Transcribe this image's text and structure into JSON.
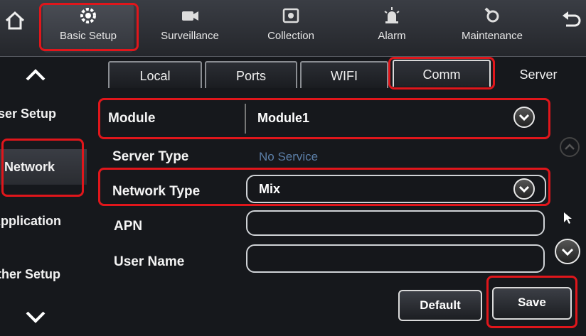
{
  "nav": {
    "items": [
      {
        "label": "Basic Setup",
        "icon": "gear-icon"
      },
      {
        "label": "Surveillance",
        "icon": "camera-icon"
      },
      {
        "label": "Collection",
        "icon": "record-icon"
      },
      {
        "label": "Alarm",
        "icon": "alarm-icon"
      },
      {
        "label": "Maintenance",
        "icon": "wrench-icon"
      }
    ]
  },
  "tabs": [
    "Local",
    "Ports",
    "WIFI",
    "Comm",
    "Server"
  ],
  "side": [
    "User Setup",
    "Network",
    "Application",
    "Other Setup"
  ],
  "form": {
    "module_label": "Module",
    "module_value": "Module1",
    "server_type_label": "Server Type",
    "server_type_value": "No Service",
    "network_type_label": "Network Type",
    "network_type_value": "Mix",
    "apn_label": "APN",
    "apn_value": "",
    "username_label": "User Name",
    "username_value": ""
  },
  "buttons": {
    "default": "Default",
    "save": "Save"
  },
  "colors": {
    "highlight": "#e0161b",
    "dim_text": "#5c7fa8"
  }
}
